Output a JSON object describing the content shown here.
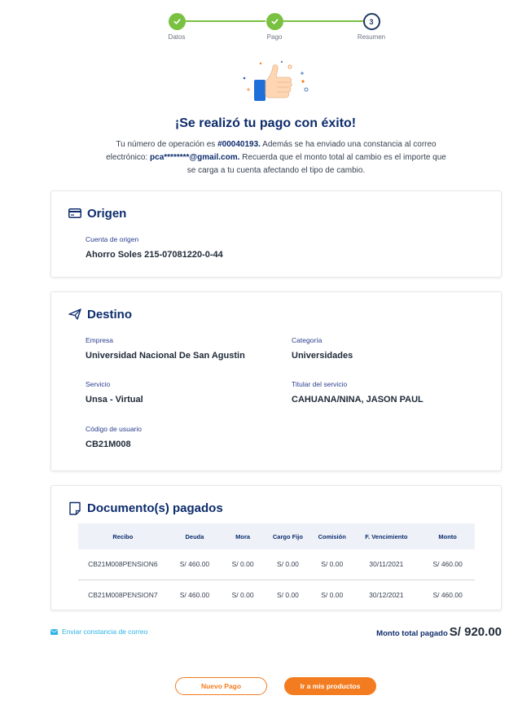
{
  "stepper": {
    "steps": [
      {
        "label": "Datos",
        "status": "done"
      },
      {
        "label": "Pago",
        "status": "done"
      },
      {
        "label": "Resumen",
        "status": "current",
        "number": "3"
      }
    ]
  },
  "success": {
    "title": "¡Se realizó tu pago con éxito!",
    "desc_1": "Tu número de operación es ",
    "operation_number": "#00040193.",
    "desc_2": " Además se ha enviado una constancia al correo electrónico: ",
    "email": "pca********@gmail.com.",
    "desc_3": " Recuerda que el monto total al cambio es el importe que se carga a tu cuenta afectando el tipo de cambio."
  },
  "origen": {
    "title": "Origen",
    "account_label": "Cuenta de origen",
    "account_value": "Ahorro Soles 215-07081220-0-44"
  },
  "destino": {
    "title": "Destino",
    "empresa_label": "Empresa",
    "empresa_value": "Universidad Nacional De San Agustin",
    "categoria_label": "Categoría",
    "categoria_value": "Universidades",
    "servicio_label": "Servicio",
    "servicio_value": "Unsa - Virtual",
    "titular_label": "Titular del servicio",
    "titular_value": "CAHUANA/NINA, JASON PAUL",
    "codigo_label": "Código de usuario",
    "codigo_value": "CB21M008"
  },
  "documentos": {
    "title": "Documento(s) pagados",
    "headers": [
      "Recibo",
      "Deuda",
      "Mora",
      "Cargo Fijo",
      "Comisión",
      "F. Vencimiento",
      "Monto"
    ],
    "rows": [
      [
        "CB21M008PENSION6",
        "S/ 460.00",
        "S/ 0.00",
        "S/ 0.00",
        "S/ 0.00",
        "30/11/2021",
        "S/ 460.00"
      ],
      [
        "CB21M008PENSION7",
        "S/ 460.00",
        "S/ 0.00",
        "S/ 0.00",
        "S/ 0.00",
        "30/12/2021",
        "S/ 460.00"
      ]
    ]
  },
  "footer": {
    "send_link": "Enviar constancia de correo",
    "total_label": "Monto total pagado",
    "total_value": "S/ 920.00"
  },
  "buttons": {
    "new_payment": "Nuevo Pago",
    "my_products": "Ir a mis productos"
  },
  "colors": {
    "primary": "#0d2c6c",
    "success": "#7ac142",
    "accent": "#f47c20",
    "link": "#2db3e5"
  },
  "icons": {
    "step_done": "check-icon",
    "origen": "card-icon",
    "destino": "paper-plane-icon",
    "documentos": "document-icon",
    "send": "mail-icon",
    "illustration": "thumbs-up-icon"
  }
}
